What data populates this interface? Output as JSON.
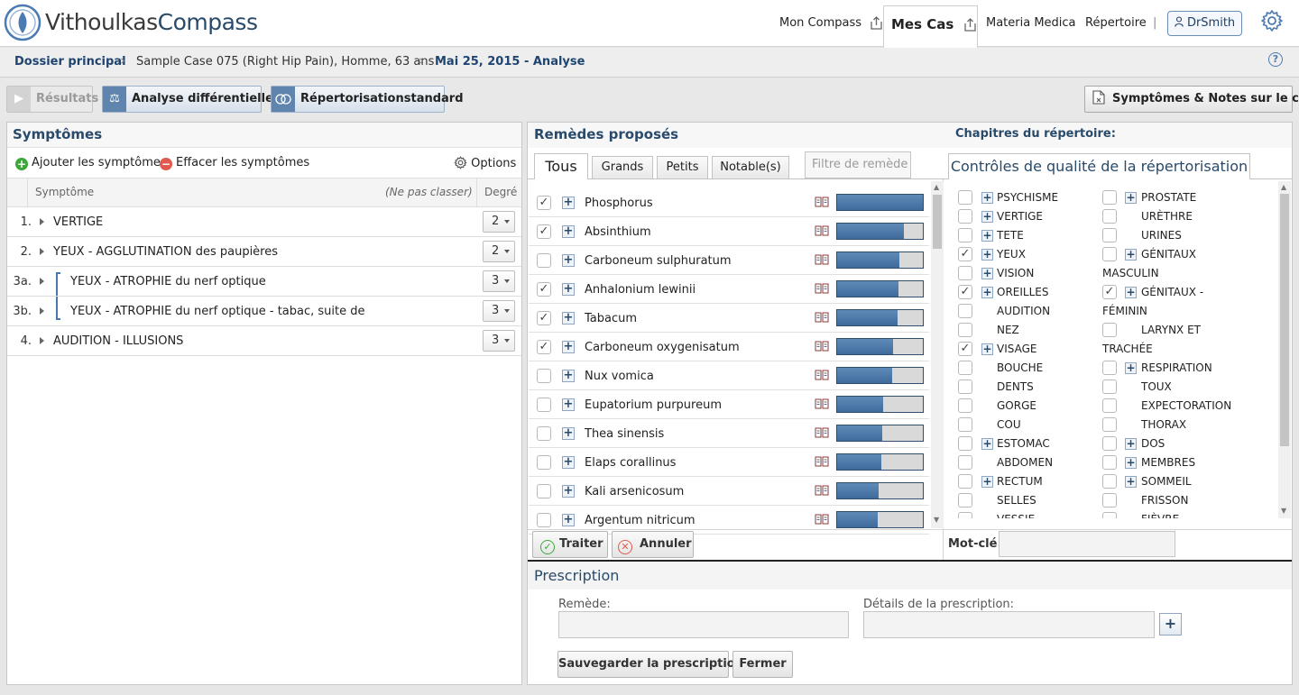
{
  "header": {
    "brand_part1": "Vithoulkas",
    "brand_part2": "Compass",
    "nav": {
      "mon_compass": "Mon Compass",
      "mes_cas": "Mes Cas",
      "materia_medica": "Materia Medica",
      "repertoire": "Répertoire",
      "separator": "|",
      "user": "DrSmith"
    }
  },
  "breadcrumb": {
    "items": [
      "Dossier principal",
      "Sample Case 075 (Right Hip Pain), Homme, 63 ans",
      "Mai 25, 2015 - Analyse"
    ],
    "separator": "›",
    "help": "?"
  },
  "toolbar": {
    "resultats": "Résultats",
    "analyse": "Analyse différentielle",
    "repertorisation": "Répertorisationstandard",
    "notes": "Symptômes & Notes sur le cas"
  },
  "symptoms": {
    "title": "Symptômes",
    "add_label": "Ajouter les symptômes",
    "clear_label": "Effacer les symptômes",
    "options_label": "Options",
    "col_symptom": "Symptôme",
    "col_noclass": "(Ne pas classer)",
    "col_degree": "Degré",
    "rows": [
      {
        "num": "1.",
        "text": "VERTIGE",
        "degree": "2"
      },
      {
        "num": "2.",
        "text": "YEUX - AGGLUTINATION des paupières",
        "degree": "2"
      },
      {
        "num": "3a.",
        "text": "YEUX - ATROPHIE du nerf optique",
        "degree": "3"
      },
      {
        "num": "3b.",
        "text": "YEUX - ATROPHIE du nerf optique - tabac, suite de",
        "degree": "3"
      },
      {
        "num": "4.",
        "text": "AUDITION - ILLUSIONS",
        "degree": "3"
      }
    ]
  },
  "remedies": {
    "title": "Remèdes proposés",
    "tabs": [
      "Tous",
      "Grands",
      "Petits",
      "Notable(s)"
    ],
    "filter_placeholder": "Filtre de remède",
    "items": [
      {
        "name": "Phosphorus",
        "checked": true,
        "score": 1.0
      },
      {
        "name": "Absinthium",
        "checked": true,
        "score": 0.78
      },
      {
        "name": "Carboneum sulphuratum",
        "checked": false,
        "score": 0.73
      },
      {
        "name": "Anhalonium lewinii",
        "checked": true,
        "score": 0.72
      },
      {
        "name": "Tabacum",
        "checked": true,
        "score": 0.7
      },
      {
        "name": "Carboneum oxygenisatum",
        "checked": true,
        "score": 0.65
      },
      {
        "name": "Nux vomica",
        "checked": false,
        "score": 0.64
      },
      {
        "name": "Eupatorium purpureum",
        "checked": false,
        "score": 0.54
      },
      {
        "name": "Thea sinensis",
        "checked": false,
        "score": 0.53
      },
      {
        "name": "Elaps corallinus",
        "checked": false,
        "score": 0.52
      },
      {
        "name": "Kali arsenicosum",
        "checked": false,
        "score": 0.48
      },
      {
        "name": "Argentum nitricum",
        "checked": false,
        "score": 0.47
      }
    ],
    "process_label": "Traiter",
    "cancel_label": "Annuler"
  },
  "chapters": {
    "title": "Chapitres du répertoire:",
    "tab_label": "Contrôles de qualité de la répertorisation",
    "keyword_label": "Mot-clé:",
    "left": [
      {
        "label": "PSYCHISME",
        "checked": false,
        "plus": true
      },
      {
        "label": "VERTIGE",
        "checked": false,
        "plus": true
      },
      {
        "label": "TETE",
        "checked": false,
        "plus": true
      },
      {
        "label": "YEUX",
        "checked": true,
        "plus": true
      },
      {
        "label": "VISION",
        "checked": false,
        "plus": true
      },
      {
        "label": "OREILLES",
        "checked": true,
        "plus": true
      },
      {
        "label": "AUDITION",
        "checked": false,
        "plus": false
      },
      {
        "label": "NEZ",
        "checked": false,
        "plus": false
      },
      {
        "label": "VISAGE",
        "checked": true,
        "plus": true
      },
      {
        "label": "BOUCHE",
        "checked": false,
        "plus": false
      },
      {
        "label": "DENTS",
        "checked": false,
        "plus": false
      },
      {
        "label": "GORGE",
        "checked": false,
        "plus": false
      },
      {
        "label": "COU",
        "checked": false,
        "plus": false
      },
      {
        "label": "ESTOMAC",
        "checked": false,
        "plus": true
      },
      {
        "label": "ABDOMEN",
        "checked": false,
        "plus": false
      },
      {
        "label": "RECTUM",
        "checked": false,
        "plus": true
      },
      {
        "label": "SELLES",
        "checked": false,
        "plus": false
      },
      {
        "label": "VESSIE",
        "checked": false,
        "plus": false
      }
    ],
    "right": [
      {
        "label": "PROSTATE",
        "checked": false,
        "plus": true,
        "cont": ""
      },
      {
        "label": "URÈTHRE",
        "checked": false,
        "plus": false,
        "cont": ""
      },
      {
        "label": "URINES",
        "checked": false,
        "plus": false,
        "cont": ""
      },
      {
        "label": "GÉNITAUX",
        "checked": false,
        "plus": true,
        "cont": "MASCULIN"
      },
      {
        "label": "GÉNITAUX -",
        "checked": true,
        "plus": true,
        "cont": "FÉMININ"
      },
      {
        "label": "LARYNX ET",
        "checked": false,
        "plus": false,
        "cont": "TRACHÉE"
      },
      {
        "label": "RESPIRATION",
        "checked": false,
        "plus": true,
        "cont": ""
      },
      {
        "label": "TOUX",
        "checked": false,
        "plus": false,
        "cont": ""
      },
      {
        "label": "EXPECTORATION",
        "checked": false,
        "plus": false,
        "cont": ""
      },
      {
        "label": "THORAX",
        "checked": false,
        "plus": false,
        "cont": ""
      },
      {
        "label": "DOS",
        "checked": false,
        "plus": true,
        "cont": ""
      },
      {
        "label": "MEMBRES",
        "checked": false,
        "plus": true,
        "cont": ""
      },
      {
        "label": "SOMMEIL",
        "checked": false,
        "plus": true,
        "cont": ""
      },
      {
        "label": "FRISSON",
        "checked": false,
        "plus": false,
        "cont": ""
      },
      {
        "label": "FIÈVRE",
        "checked": false,
        "plus": false,
        "cont": ""
      }
    ]
  },
  "prescription": {
    "title": "Prescription",
    "remede_label": "Remède:",
    "details_label": "Détails de la prescription:",
    "save_label": "Sauvegarder la prescription",
    "close_label": "Fermer",
    "add": "+"
  },
  "colors": {
    "accent": "#2a4a6a",
    "bar_fill": "#4a76a6",
    "add_green": "#3da83a",
    "clear_red": "#e05a4f"
  }
}
